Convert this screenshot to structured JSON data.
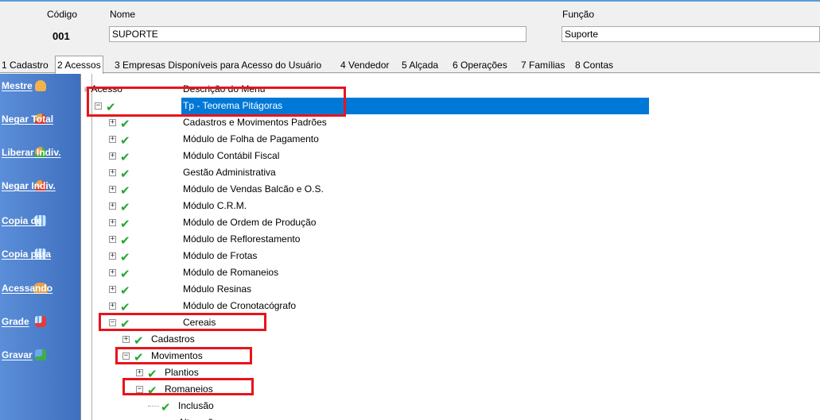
{
  "header": {
    "codigo_label": "Código",
    "codigo_value": "001",
    "nome_label": "Nome",
    "nome_value": "SUPORTE",
    "funcao_label": "Função",
    "funcao_value": "Suporte"
  },
  "tabs": [
    {
      "label": "1 Cadastro"
    },
    {
      "label": "2 Acessos"
    },
    {
      "label": "3 Empresas Disponíveis para Acesso do Usuário"
    },
    {
      "label": "4 Vendedor"
    },
    {
      "label": "5 Alçada"
    },
    {
      "label": "6 Operações"
    },
    {
      "label": "7 Famílias"
    },
    {
      "label": "8 Contas"
    }
  ],
  "sidebar": [
    {
      "label": "Mestre",
      "icon": "user-icon"
    },
    {
      "label": "Negar Total",
      "icon": "user-deny-icon"
    },
    {
      "label": "Liberar Indiv.",
      "icon": "user-allow-icon"
    },
    {
      "label": "Negar Indiv.",
      "icon": "user-remove-icon"
    },
    {
      "label": "Copia de",
      "icon": "grid-icon"
    },
    {
      "label": "Copia para",
      "icon": "grid-icon"
    },
    {
      "label": "Acessando",
      "icon": "users-icon"
    },
    {
      "label": "Grade",
      "icon": "grid-delete-icon"
    },
    {
      "label": "Gravar",
      "icon": "save-icon"
    }
  ],
  "tree": {
    "col_acesso": "Acesso",
    "col_descricao": "Descrição do Menu",
    "rows": [
      {
        "label": "Tp - Teorema Pitágoras"
      },
      {
        "label": "Cadastros e Movimentos Padrões"
      },
      {
        "label": "Módulo de Folha de Pagamento"
      },
      {
        "label": "Módulo Contábil Fiscal"
      },
      {
        "label": "Gestão Administrativa"
      },
      {
        "label": "Módulo de Vendas Balcão e O.S."
      },
      {
        "label": "Módulo C.R.M."
      },
      {
        "label": "Módulo de Ordem de Produção"
      },
      {
        "label": "Módulo de Reflorestamento"
      },
      {
        "label": "Módulo de Frotas"
      },
      {
        "label": "Módulo de Romaneios"
      },
      {
        "label": "Módulo Resinas"
      },
      {
        "label": "Módulo de Cronotacógrafo"
      },
      {
        "label": "Cereais"
      },
      {
        "label": "Cadastros"
      },
      {
        "label": "Movimentos"
      },
      {
        "label": "Plantios"
      },
      {
        "label": "Romaneios"
      },
      {
        "label": "Inclusão"
      },
      {
        "label": "Alteração"
      }
    ]
  },
  "colors": {
    "selection": "#0078d7",
    "check": "#22a832",
    "highlight": "#e8141b",
    "sidebar": "#4a7fcf"
  }
}
